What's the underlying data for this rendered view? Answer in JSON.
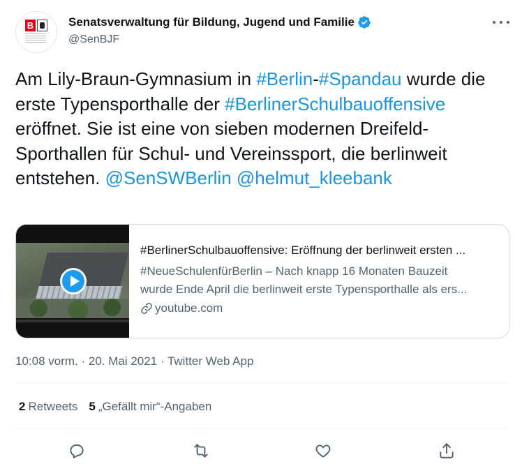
{
  "author": {
    "display_name": "Senatsverwaltung für Bildung, Jugend und Familie",
    "handle": "@SenBJF",
    "avatar_logo_letter": "B"
  },
  "tweet": {
    "segments": [
      {
        "text": "Am Lily-Braun-Gymnasium in ",
        "link": false
      },
      {
        "text": "#Berlin",
        "link": true
      },
      {
        "text": "-",
        "link": false
      },
      {
        "text": "#Spandau",
        "link": true
      },
      {
        "text": " wurde die erste Typensporthalle der ",
        "link": false
      },
      {
        "text": "#BerlinerSchulbauoffensive",
        "link": true
      },
      {
        "text": " eröffnet. Sie ist eine von sieben modernen Dreifeld-Sporthallen für Schul- und Vereinssport, die berlinweit entstehen. ",
        "link": false
      },
      {
        "text": "@SenSWBerlin",
        "link": true
      },
      {
        "text": " ",
        "link": false
      },
      {
        "text": "@helmut_kleebank",
        "link": true
      }
    ]
  },
  "card": {
    "title": "#BerlinerSchulbauoffensive: Eröffnung der berlinweit ersten ...",
    "desc_line1": "#NeueSchulenfürBerlin – Nach knapp 16 Monaten Bauzeit",
    "desc_line2": "wurde Ende April die berlinweit erste Typensporthalle als ers...",
    "domain": "youtube.com"
  },
  "meta": {
    "timestamp": "10:08 vorm. · 20. Mai 2021 · Twitter Web App"
  },
  "stats": {
    "retweets_count": "2",
    "retweets_label": "Retweets",
    "likes_count": "5",
    "likes_label": "„Gefällt mir“-Angaben"
  },
  "colors": {
    "link": "#1b95e0",
    "secondary_text": "#536471",
    "verified": "#1d9bf0"
  },
  "icons": [
    "verified-icon",
    "more-icon",
    "play-icon",
    "link-icon",
    "reply-icon",
    "retweet-icon",
    "like-icon",
    "share-icon"
  ]
}
